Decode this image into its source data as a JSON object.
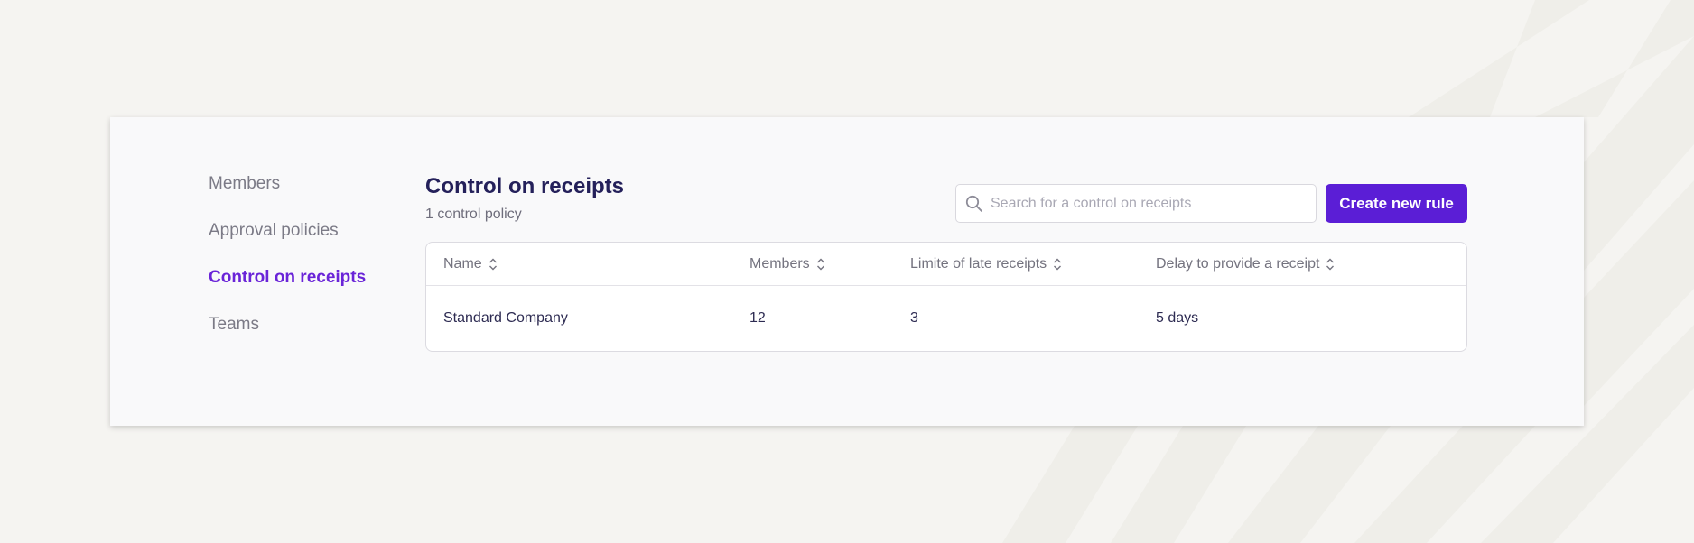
{
  "sidebar": {
    "items": [
      {
        "label": "Members",
        "active": false
      },
      {
        "label": "Approval policies",
        "active": false
      },
      {
        "label": "Control on receipts",
        "active": true
      },
      {
        "label": "Teams",
        "active": false
      }
    ]
  },
  "header": {
    "title": "Control on receipts",
    "subtitle": "1 control policy"
  },
  "search": {
    "placeholder": "Search for a control on receipts",
    "value": "",
    "icon": "search-icon"
  },
  "toolbar": {
    "create_label": "Create new rule"
  },
  "table": {
    "columns": [
      {
        "label": "Name",
        "sort_icon": "sort-icon"
      },
      {
        "label": "Members",
        "sort_icon": "sort-icon"
      },
      {
        "label": "Limite of late receipts",
        "sort_icon": "sort-icon"
      },
      {
        "label": "Delay to provide a receipt",
        "sort_icon": "sort-icon"
      }
    ],
    "rows": [
      {
        "name": "Standard Company",
        "members": "12",
        "limit": "3",
        "delay": "5 days"
      }
    ]
  },
  "colors": {
    "accent": "#5b1ed6",
    "active_nav": "#6a24d8",
    "title": "#24205a",
    "background": "#f5f4f1",
    "card": "#f9f9fa"
  }
}
